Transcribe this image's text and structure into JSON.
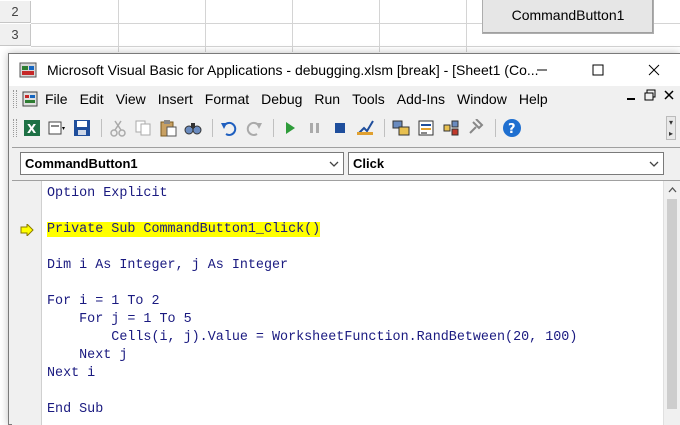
{
  "excel": {
    "rows": [
      "2",
      "3"
    ],
    "command_button": "CommandButton1"
  },
  "window": {
    "title": "Microsoft Visual Basic for Applications - debugging.xlsm [break] - [Sheet1 (Co..."
  },
  "menu": {
    "items": [
      "File",
      "Edit",
      "View",
      "Insert",
      "Format",
      "Debug",
      "Run",
      "Tools",
      "Add-Ins",
      "Window",
      "Help"
    ]
  },
  "toolbar": {
    "icons": [
      "excel-icon",
      "insert-module-icon",
      "save-icon",
      "cut-icon",
      "copy-icon",
      "paste-icon",
      "find-icon",
      "undo-icon",
      "redo-icon",
      "run-icon",
      "break-icon",
      "reset-icon",
      "design-mode-icon",
      "project-explorer-icon",
      "properties-icon",
      "object-browser-icon",
      "toolbox-icon",
      "help-icon"
    ]
  },
  "code_window": {
    "object_combo": "CommandButton1",
    "procedure_combo": "Click",
    "lines": [
      "Option Explicit",
      "",
      "Private Sub CommandButton1_Click()",
      "",
      "Dim i As Integer, j As Integer",
      "",
      "For i = 1 To 2",
      "    For j = 1 To 5",
      "        Cells(i, j).Value = WorksheetFunction.RandBetween(20, 100)",
      "    Next j",
      "Next i",
      "",
      "End Sub"
    ],
    "highlighted_line_index": 2
  },
  "colors": {
    "highlight": "#ffff00",
    "code_text": "#1a1a80"
  }
}
